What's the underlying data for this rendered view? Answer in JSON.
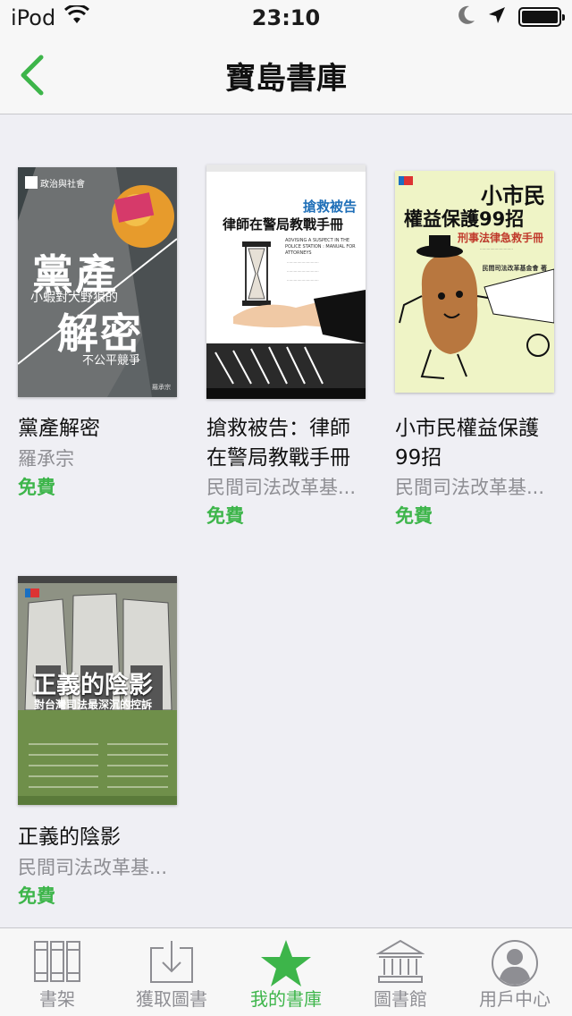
{
  "status": {
    "carrier": "iPod",
    "time": "23:10"
  },
  "nav": {
    "title": "寶島書庫"
  },
  "books": [
    {
      "title": "黨產解密",
      "author": "羅承宗",
      "price": "免費",
      "cover": {
        "title_top": "黨產",
        "title_bottom": "解密",
        "subtitle": "小蝦對大野狼的",
        "tag": "不公平競爭",
        "bg": "#6b6e6f"
      }
    },
    {
      "title": "搶救被告：律師在警局教戰手冊",
      "title_lines": [
        "搶救被告：律師",
        "在警局教戰手冊"
      ],
      "author": "民間司法改革基...",
      "price": "免費",
      "cover": {
        "top": "搶救被告",
        "main": "律師在警局教戰手冊",
        "en": "ADVISING A SUSPECT IN THE POLICE STATION : MANUAL FOR ATTORNEYS"
      }
    },
    {
      "title": "小市民權益保護99招",
      "title_lines": [
        "小市民權益保護",
        "99招"
      ],
      "author": "民間司法改革基...",
      "price": "免費",
      "cover": {
        "line1": "小市民",
        "line2": "權益保護99招",
        "line3": "刑事法律急救手冊",
        "pub": "民間司法改革基金會 著"
      }
    },
    {
      "title": "正義的陰影",
      "author": "民間司法改革基...",
      "price": "免費",
      "cover": {
        "main": "正義的陰影",
        "sub": "對台灣司法最深沉的控訴"
      }
    }
  ],
  "tabs": [
    {
      "label": "書架",
      "icon": "bookshelf-icon",
      "active": false
    },
    {
      "label": "獲取圖書",
      "icon": "download-icon",
      "active": false
    },
    {
      "label": "我的書庫",
      "icon": "star-icon",
      "active": true
    },
    {
      "label": "圖書館",
      "icon": "library-icon",
      "active": false
    },
    {
      "label": "用戶中心",
      "icon": "user-icon",
      "active": false
    }
  ],
  "colors": {
    "accent": "#3db54a",
    "muted": "#8e8e93"
  }
}
